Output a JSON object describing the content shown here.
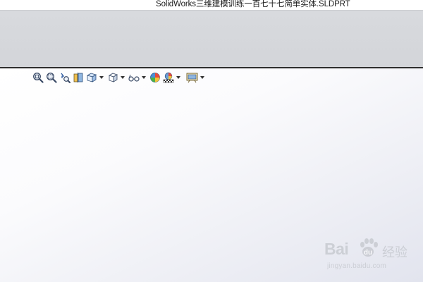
{
  "window": {
    "title": "SolidWorks三维建模训练一百七十七简单实体.SLDPRT"
  },
  "heads_up_toolbar": {
    "items": [
      {
        "icon": "zoom-to-fit-icon"
      },
      {
        "icon": "zoom-to-area-icon"
      },
      {
        "icon": "previous-view-icon"
      },
      {
        "icon": "section-view-icon"
      },
      {
        "icon": "view-orientation-icon",
        "dropdown": true
      },
      {
        "icon": "display-style-icon",
        "dropdown": true
      },
      {
        "icon": "hide-show-items-icon",
        "dropdown": true
      },
      {
        "icon": "edit-appearance-icon"
      },
      {
        "icon": "apply-scene-icon",
        "dropdown": true
      },
      {
        "icon": "view-settings-icon",
        "dropdown": true
      }
    ]
  },
  "watermark": {
    "brand": "Bai",
    "brand_suffix": "经验",
    "url": "jingyan.baidu.com"
  },
  "colors": {
    "ribbon": "#d6d8dc",
    "viewport_start": "#ffffff",
    "viewport_end": "#e2e4ee",
    "divider": "#2e2e2e"
  }
}
